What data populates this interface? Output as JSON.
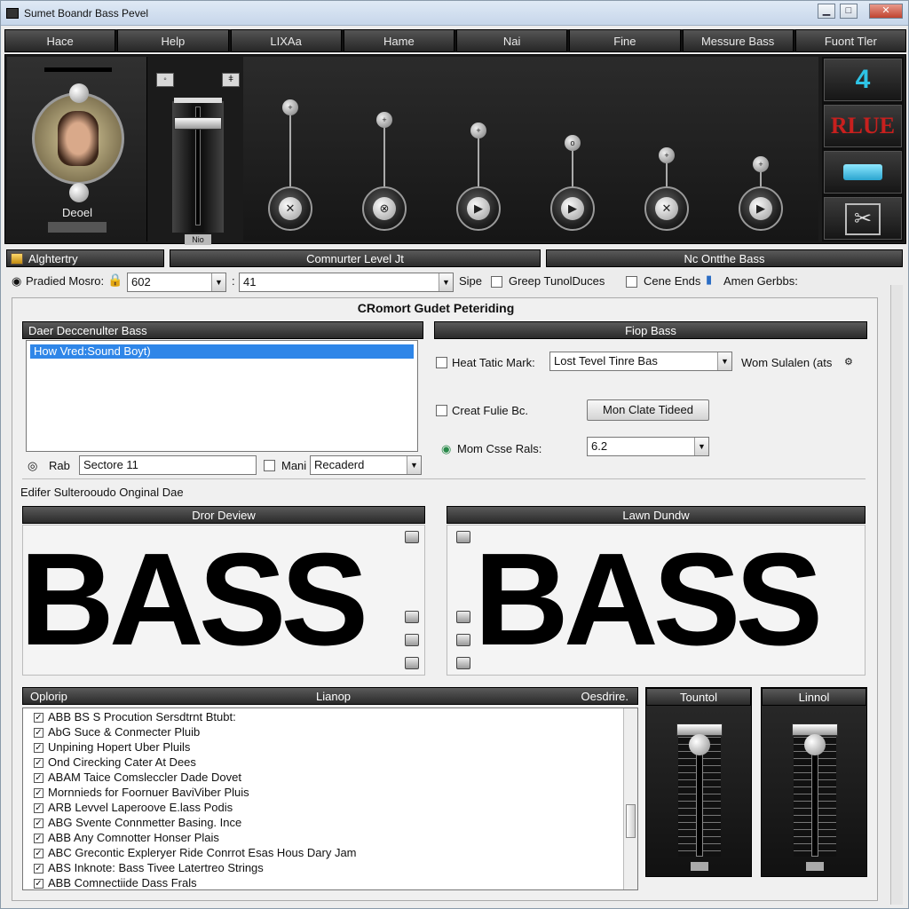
{
  "window": {
    "title": "Sumet Boandr Bass Pevel"
  },
  "menu": [
    "Hace",
    "Help",
    "LIXAa",
    "Hame",
    "Nai",
    "Fine",
    "Messure Bass",
    "Fuont Tler"
  ],
  "top_panel": {
    "left_label": "Deoel",
    "fader_label": "Nio",
    "right_buttons": {
      "number": "4",
      "blue_label": "RLUE"
    }
  },
  "sections": {
    "left": "Alghtertry",
    "center": "Comnurter Level Jt",
    "right": "Nc Ontthe Bass"
  },
  "toolbar": {
    "preset_label": "Pradied Mosro:",
    "preset_value": "602",
    "level_value": "41",
    "sipe_label": "Sipe",
    "greep_label": "Greep TunolDuces",
    "cone_label": "Cene Ends",
    "amen_label": "Amen Gerbbs:"
  },
  "group_title": "CRomort Gudet Peteriding",
  "left_box": {
    "header": "Daer Deccenulter Bass",
    "selected_item": "How Vred:Sound Boyt)",
    "rate_label": "Rab",
    "rate_value": "Sectore 11",
    "mani_label": "Mani",
    "mani_value": "Recaderd"
  },
  "right_box": {
    "header": "Fiop Bass",
    "heat_label": "Heat Tatic Mark:",
    "heat_value": "Lost Tevel Tinre Bas",
    "wom_label": "Wom Sulalen (ats",
    "create_label": "Creat Fulie Bc.",
    "button_label": "Mon Clate Tideed",
    "mom_label": "Mom Csse Rals:",
    "mom_value": "6.2"
  },
  "editor_label": "Edifer Sulterooudo Onginal Dae",
  "previews": {
    "left": {
      "header": "Dror Deview",
      "text": "BASS"
    },
    "right": {
      "header": "Lawn Dundw",
      "text": "BASS"
    }
  },
  "list_section": {
    "col1": "Oplorip",
    "col2": "Lianop",
    "col3": "Oesdrire.",
    "items": [
      "ABB BS S Procution Sersdtrnt Btubt:",
      "AbG Suce & Conmecter Pluib",
      "Unpining Hopert Uber Pluils",
      "Ond Cirecking Cater At Dees",
      "ABAM Taice Comsleccler Dade Dovet",
      "Mornnieds for Foornuer BaviViber Pluis",
      "ARB Levvel Laperoove E.lass Podis",
      "ABG Svente Connmetter Basing. Ince",
      "ABB Any Comnotter Honser Plais",
      "ABC Grecontic Expleryer Ride Conrrot Esas Hous Dary Jam",
      "ABS Inknote: Bass Tivee Latertreo Strings",
      "ABB Comnectiide Dass Frals"
    ]
  },
  "faders": {
    "left": "Tountol",
    "right": "Linnol"
  }
}
